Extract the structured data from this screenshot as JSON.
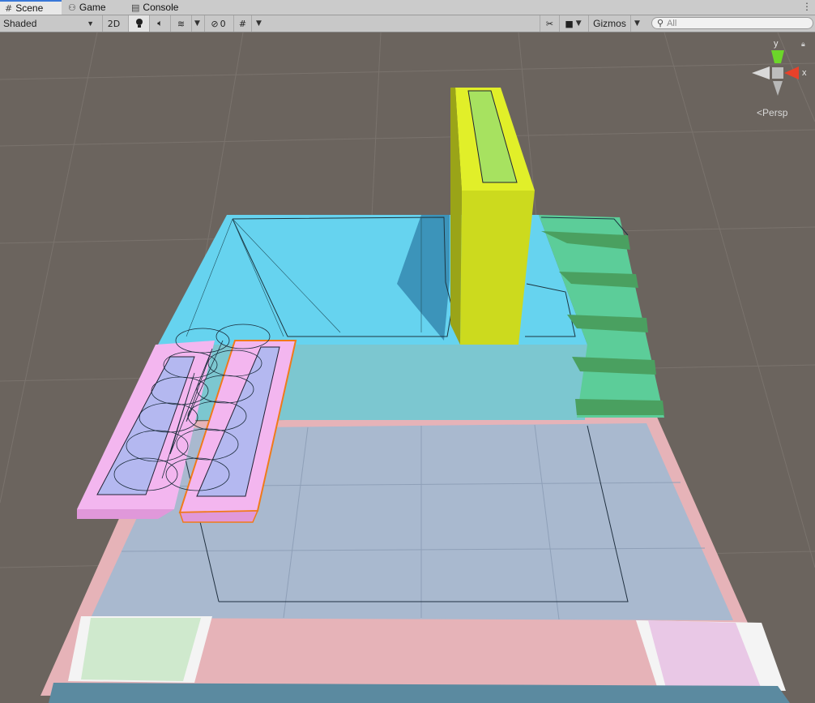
{
  "tabs": [
    {
      "label": "Scene",
      "icon": "grid-icon",
      "active": true
    },
    {
      "label": "Game",
      "icon": "gamepad-icon",
      "active": false
    },
    {
      "label": "Console",
      "icon": "console-list-icon",
      "active": false
    }
  ],
  "toolbar": {
    "draw_mode": "Shaded",
    "toggle_2d": "2D",
    "hidden_count": "0",
    "gizmos_label": "Gizmos",
    "search_placeholder": "All"
  },
  "gizmo": {
    "y_label": "y",
    "x_label": "x",
    "projection_label": "Persp"
  },
  "colors": {
    "ground": "#6b645e",
    "blue_platform": "#66d3ef",
    "yellow_wall": "#ccda1e",
    "green_stairs": "#5ccd99",
    "pink_ramp": "#f3b6ef",
    "floor": "#a9b9cf",
    "floor_border": "#e6b3b8",
    "selection_outline": "#f07a1a"
  }
}
